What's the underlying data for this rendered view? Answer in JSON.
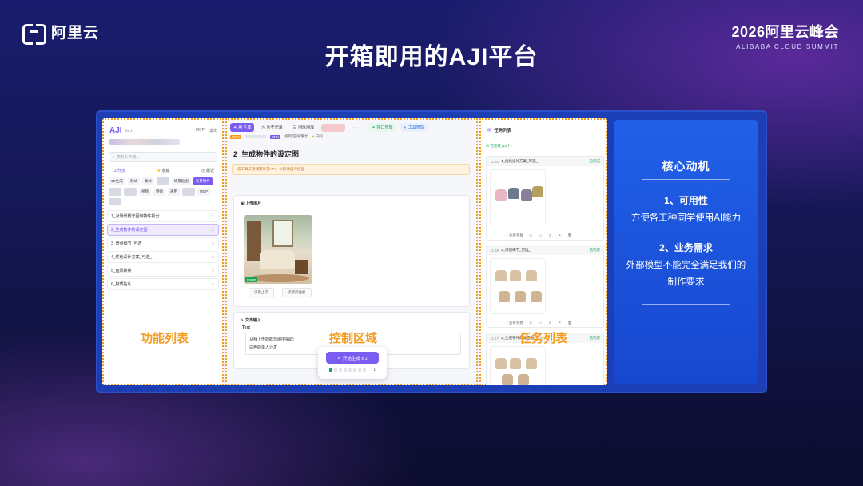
{
  "slide": {
    "logo_text": "阿里云",
    "summit_title": "2026阿里云峰会",
    "summit_sub": "ALIBABA CLOUD SUMMIT",
    "title": "开箱即用的AJI平台"
  },
  "left_panel": {
    "app_name": "AJI",
    "version": "v2.1",
    "links": [
      "MCP",
      "退出"
    ],
    "search_placeholder": "搜索工作流...",
    "tabs": [
      "工作流",
      "收藏",
      "最近"
    ],
    "chips": [
      "3D生成",
      "测试",
      "素材",
      "",
      "场景贴图",
      "布景物件",
      "",
      "",
      "视频",
      "特效",
      "通用",
      "",
      "MCP",
      ""
    ],
    "items": [
      {
        "label": "1_对场景概念图做物件拆分",
        "selected": false
      },
      {
        "label": "2_生成物件的设定图",
        "selected": true
      },
      {
        "label": "3_增强细节_可选_",
        "selected": false
      },
      {
        "label": "4_优化设计方案_可选_",
        "selected": false
      },
      {
        "label": "5_画风转换",
        "selected": false
      },
      {
        "label": "6_材质贴认",
        "selected": false
      }
    ]
  },
  "center_panel": {
    "tabs": [
      "AI 生成",
      "历史记录",
      "团队圈库",
      "",
      "",
      "接口管理",
      "工具管理"
    ],
    "status": {
      "gpu": "GPU",
      "cpu": "CPU",
      "cpu_text": "排列/空闲/繁忙",
      "log": "日间"
    },
    "title": "2_生成物件的设定图",
    "warning": "该工具支持调用外部API，价格请自行核查",
    "upload_label": "上传图片",
    "image_tag": "Image",
    "buttons": [
      "读取上次",
      "读取剪贴板"
    ],
    "text_section": "文本输入",
    "text_label": "Text",
    "text_lines": [
      "从我上传的概念图中抽取:",
      "白色的单人沙发"
    ],
    "generate_label": "开始生成 x 1",
    "generate_count": "1"
  },
  "task_panel": {
    "title": "任务列表",
    "done_count": "已完成 (19个)",
    "tasks": [
      {
        "time": "11:58",
        "name": "4_优化设计方案_可选_",
        "status": "已完成",
        "more": "+ 查看参数"
      },
      {
        "time": "11:58",
        "name": "3_增强细节_可选_",
        "status": "已完成",
        "more": "+ 查看参数"
      },
      {
        "time": "11:57",
        "name": "2_生成物件的设定图",
        "status": "已完成",
        "more": ""
      }
    ]
  },
  "overlays": {
    "func": "功能列表",
    "control": "控制区域",
    "tasks": "任务列表"
  },
  "core": {
    "title": "核心动机",
    "sec1": "1、可用性",
    "txt1": "方便各工种同学使用AI能力",
    "sec2": "2、业务需求",
    "txt2": "外部模型不能完全满足我们的制作要求"
  }
}
